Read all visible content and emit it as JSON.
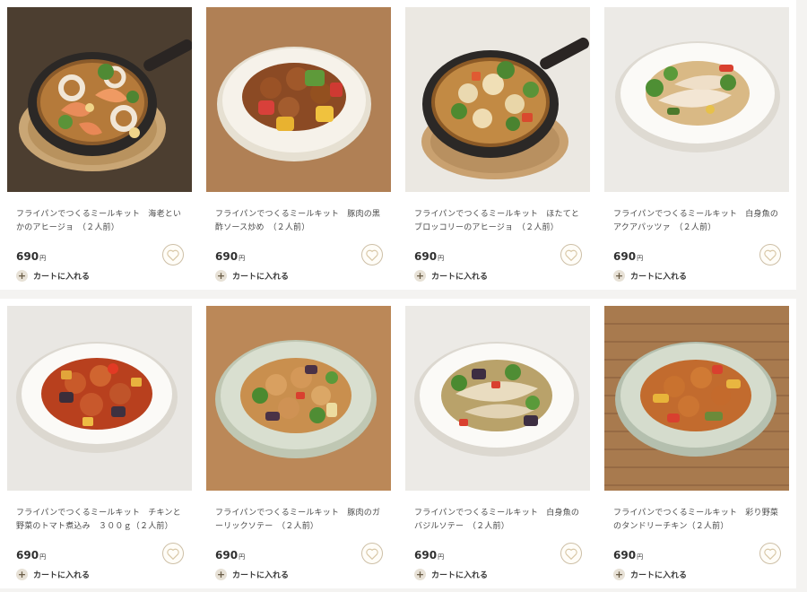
{
  "products": [
    {
      "name": "フライパンでつくるミールキット　海老といかのアヒージョ　（２人前）",
      "price": "690",
      "currency": "円",
      "cart_label": "カートに入れる",
      "image": "shrimp-squid-ajillo-in-skillet"
    },
    {
      "name": "フライパンでつくるミールキット　豚肉の黒酢ソース炒め　（２人前）",
      "price": "690",
      "currency": "円",
      "cart_label": "カートに入れる",
      "image": "pork-black-vinegar-stirfry-on-plate"
    },
    {
      "name": "フライパンでつくるミールキット　ほたてとブロッコリーのアヒージョ　（２人前）",
      "price": "690",
      "currency": "円",
      "cart_label": "カートに入れる",
      "image": "scallop-broccoli-ajillo-in-skillet"
    },
    {
      "name": "フライパンでつくるミールキット　白身魚のアクアパッツァ　（２人前）",
      "price": "690",
      "currency": "円",
      "cart_label": "カートに入れる",
      "image": "white-fish-acqua-pazza-on-plate"
    },
    {
      "name": "フライパンでつくるミールキット　チキンと野菜のトマト煮込み　３００ｇ（２人前）",
      "price": "690",
      "currency": "円",
      "cart_label": "カートに入れる",
      "image": "chicken-vegetable-tomato-stew-on-plate"
    },
    {
      "name": "フライパンでつくるミールキット　豚肉のガーリックソテー　（２人前）",
      "price": "690",
      "currency": "円",
      "cart_label": "カートに入れる",
      "image": "pork-garlic-saute-on-plate"
    },
    {
      "name": "フライパンでつくるミールキット　白身魚のバジルソテー　（２人前）",
      "price": "690",
      "currency": "円",
      "cart_label": "カートに入れる",
      "image": "white-fish-basil-saute-on-plate"
    },
    {
      "name": "フライパンでつくるミールキット　彩り野菜のタンドリーチキン（２人前）",
      "price": "690",
      "currency": "円",
      "cart_label": "カートに入れる",
      "image": "tandoori-chicken-vegetables-on-plate"
    }
  ],
  "colors": {
    "heart": "#d8c7a6",
    "cart_plus_bg": "#e7e1d6",
    "accent": "#cdbfa6"
  },
  "icons": {
    "favorite": "heart-icon",
    "add_to_cart": "plus-icon"
  }
}
